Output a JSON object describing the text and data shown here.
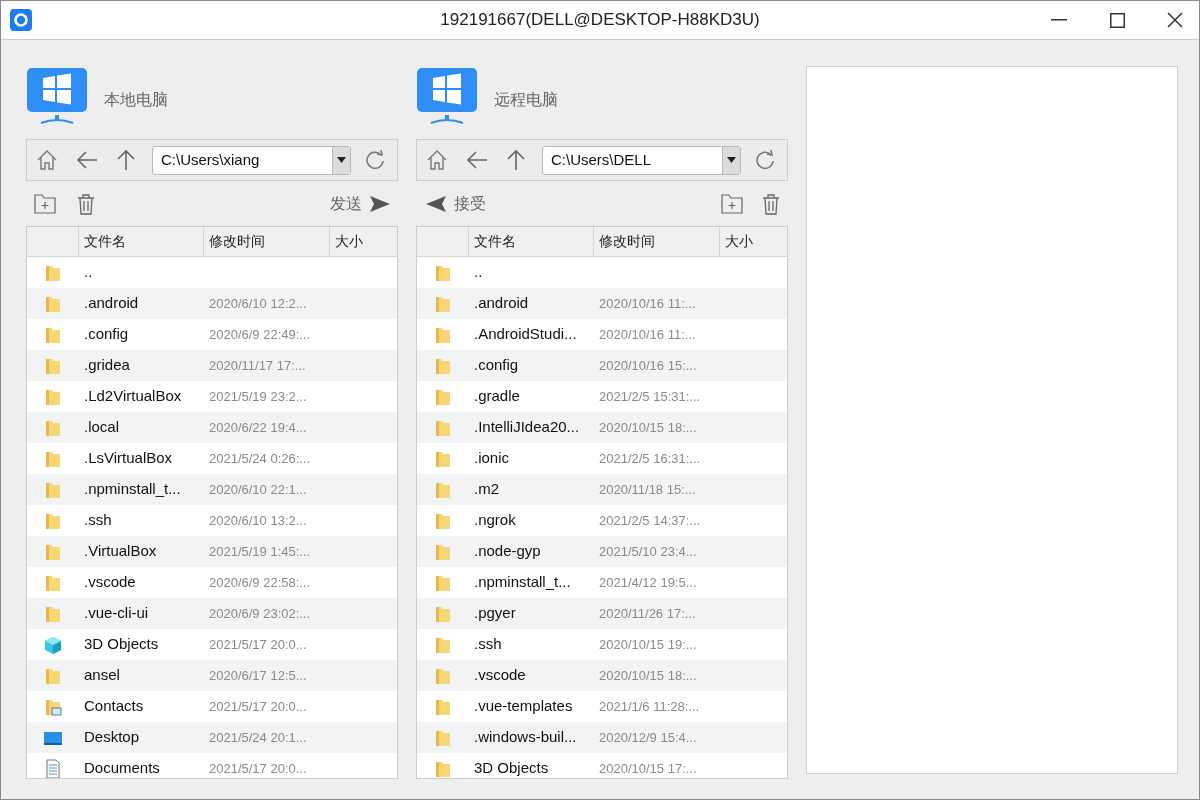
{
  "window": {
    "title": "192191667(DELL@DESKTOP-H88KD3U)"
  },
  "panels": [
    {
      "title": "本地电脑",
      "path": "C:\\Users\\xiang",
      "transfer": {
        "label": "发送",
        "kind": "send"
      },
      "columns": [
        "文件名",
        "修改时间",
        "大小"
      ],
      "rows": [
        {
          "kind": "folder",
          "name": "..",
          "modified": ""
        },
        {
          "kind": "folder",
          "name": ".android",
          "modified": "2020/6/10 12:2..."
        },
        {
          "kind": "folder",
          "name": ".config",
          "modified": "2020/6/9 22:49:..."
        },
        {
          "kind": "folder",
          "name": ".gridea",
          "modified": "2020/11/17 17:..."
        },
        {
          "kind": "folder",
          "name": ".Ld2VirtualBox",
          "modified": "2021/5/19 23:2..."
        },
        {
          "kind": "folder",
          "name": ".local",
          "modified": "2020/6/22 19:4..."
        },
        {
          "kind": "folder",
          "name": ".LsVirtualBox",
          "modified": "2021/5/24 0:26:..."
        },
        {
          "kind": "folder",
          "name": ".npminstall_t...",
          "modified": "2020/6/10 22:1..."
        },
        {
          "kind": "folder",
          "name": ".ssh",
          "modified": "2020/6/10 13:2..."
        },
        {
          "kind": "folder",
          "name": ".VirtualBox",
          "modified": "2021/5/19 1:45:..."
        },
        {
          "kind": "folder",
          "name": ".vscode",
          "modified": "2020/6/9 22:58:..."
        },
        {
          "kind": "folder",
          "name": ".vue-cli-ui",
          "modified": "2020/6/9 23:02:..."
        },
        {
          "kind": "objects3d",
          "name": "3D Objects",
          "modified": "2021/5/17 20:0..."
        },
        {
          "kind": "folder",
          "name": "ansel",
          "modified": "2020/6/17 12:5..."
        },
        {
          "kind": "contacts",
          "name": "Contacts",
          "modified": "2021/5/17 20:0..."
        },
        {
          "kind": "desktop",
          "name": "Desktop",
          "modified": "2021/5/24 20:1..."
        },
        {
          "kind": "documents",
          "name": "Documents",
          "modified": "2021/5/17 20:0..."
        }
      ]
    },
    {
      "title": "远程电脑",
      "path": "C:\\Users\\DELL",
      "transfer": {
        "label": "接受",
        "kind": "receive"
      },
      "columns": [
        "文件名",
        "修改时间",
        "大小"
      ],
      "rows": [
        {
          "kind": "folder",
          "name": "..",
          "modified": ""
        },
        {
          "kind": "folder",
          "name": ".android",
          "modified": "2020/10/16 11:..."
        },
        {
          "kind": "folder",
          "name": ".AndroidStudi...",
          "modified": "2020/10/16 11:..."
        },
        {
          "kind": "folder",
          "name": ".config",
          "modified": "2020/10/16 15:..."
        },
        {
          "kind": "folder",
          "name": ".gradle",
          "modified": "2021/2/5 15:31:..."
        },
        {
          "kind": "folder",
          "name": ".IntelliJIdea20...",
          "modified": "2020/10/15 18:..."
        },
        {
          "kind": "folder",
          "name": ".ionic",
          "modified": "2021/2/5 16:31:..."
        },
        {
          "kind": "folder",
          "name": ".m2",
          "modified": "2020/11/18 15:..."
        },
        {
          "kind": "folder",
          "name": ".ngrok",
          "modified": "2021/2/5 14:37:..."
        },
        {
          "kind": "folder",
          "name": ".node-gyp",
          "modified": "2021/5/10 23:4..."
        },
        {
          "kind": "folder",
          "name": ".npminstall_t...",
          "modified": "2021/4/12 19:5..."
        },
        {
          "kind": "folder",
          "name": ".pgyer",
          "modified": "2020/11/26 17:..."
        },
        {
          "kind": "folder",
          "name": ".ssh",
          "modified": "2020/10/15 19:..."
        },
        {
          "kind": "folder",
          "name": ".vscode",
          "modified": "2020/10/15 18:..."
        },
        {
          "kind": "folder",
          "name": ".vue-templates",
          "modified": "2021/1/6 11:28:..."
        },
        {
          "kind": "folder",
          "name": ".windows-buil...",
          "modified": "2020/12/9 15:4..."
        },
        {
          "kind": "folder",
          "name": "3D Objects",
          "modified": "2020/10/15 17:..."
        }
      ]
    }
  ]
}
